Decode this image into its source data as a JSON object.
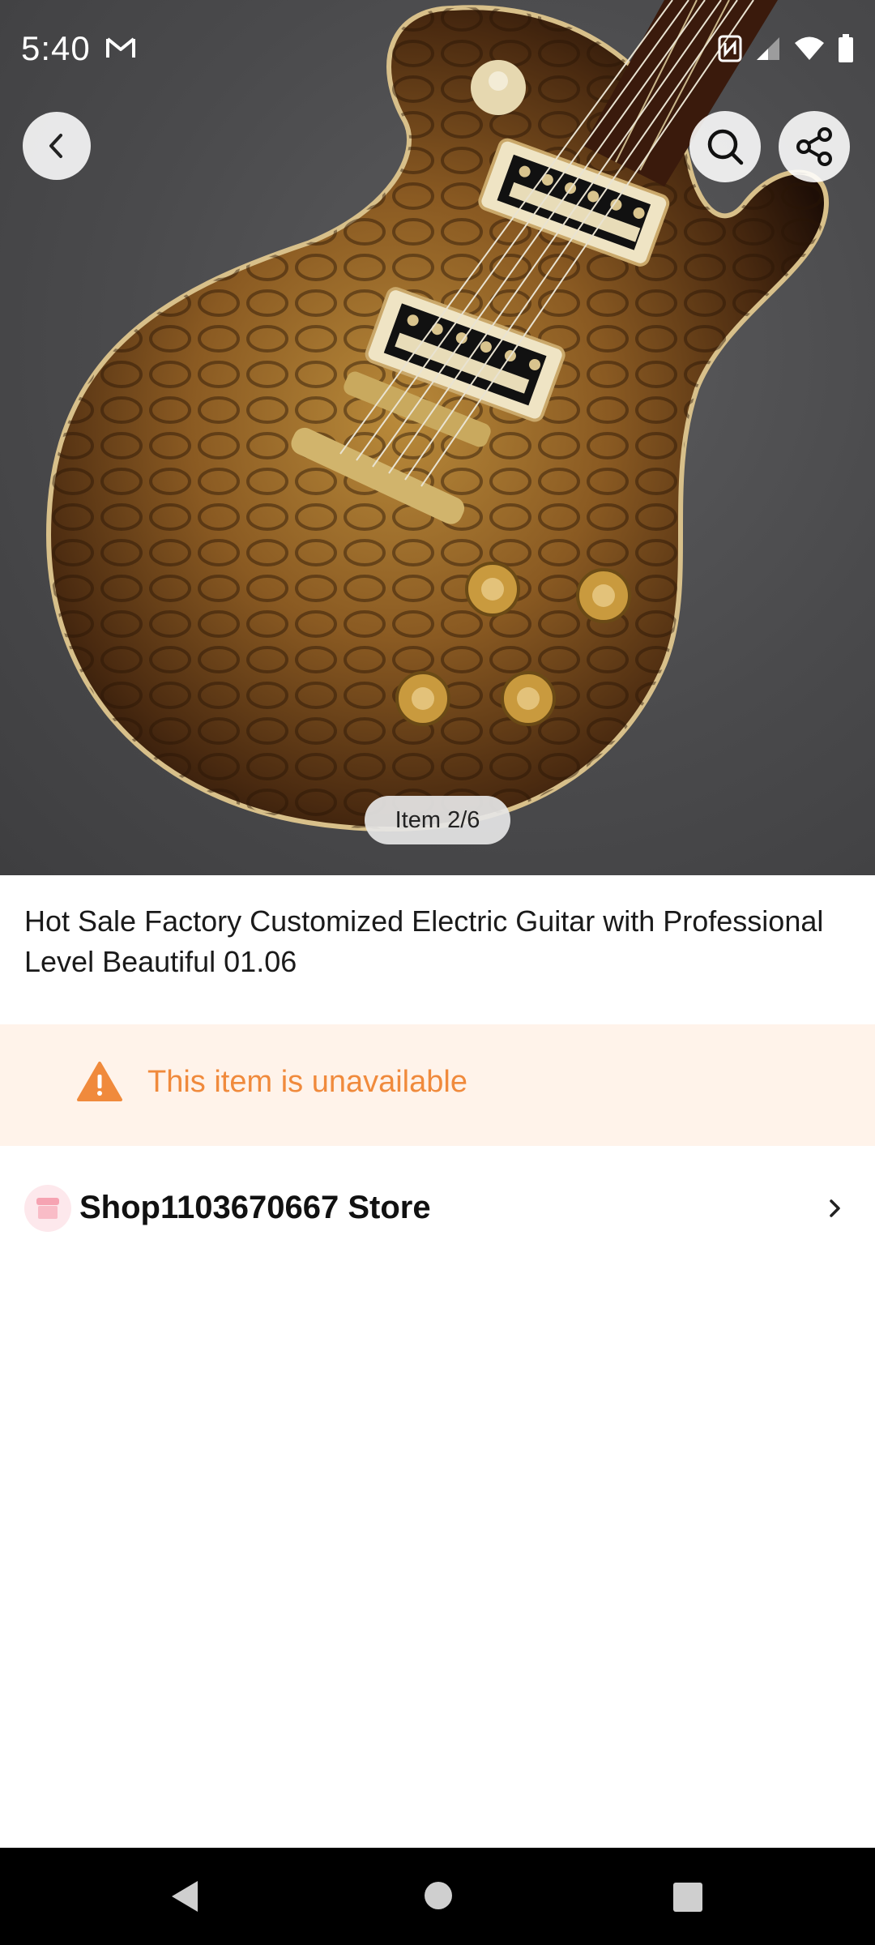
{
  "status_bar": {
    "time": "5:40",
    "icons": [
      "gmail-icon",
      "nfc-icon",
      "signal-icon",
      "wifi-icon",
      "battery-icon"
    ]
  },
  "product": {
    "image_counter": "Item 2/6",
    "title": "Hot Sale Factory Customized Electric Guitar with Professional Level Beautiful 01.06"
  },
  "availability": {
    "message": "This item is unavailable",
    "color": "#f08a3c",
    "background": "#fff3ea"
  },
  "store": {
    "name": "Shop1103670667 Store"
  },
  "header_actions": {
    "back": "chevron-left-icon",
    "search": "search-icon",
    "share": "share-icon"
  }
}
